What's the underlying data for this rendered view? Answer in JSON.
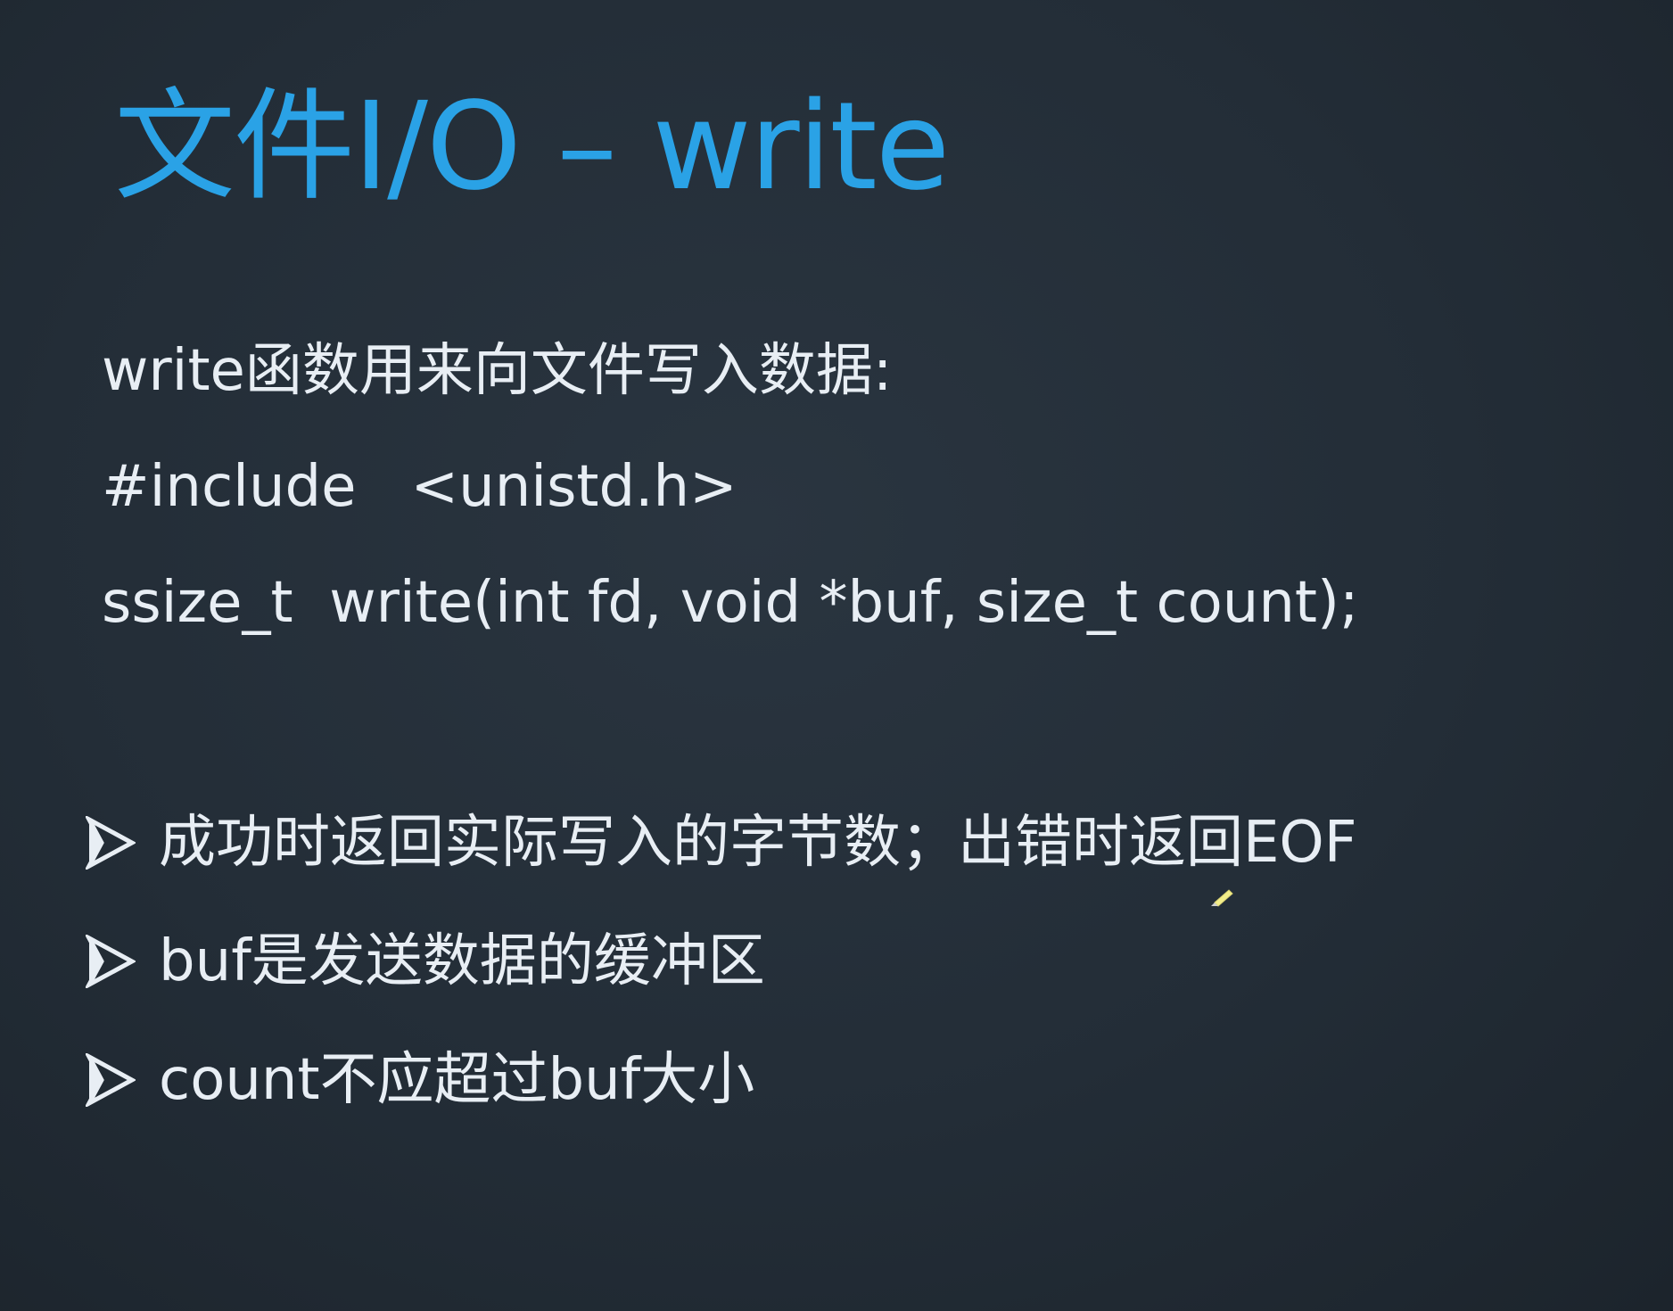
{
  "slide": {
    "title": "文件I/O – write",
    "lines": [
      "write函数用来向文件写入数据:",
      "#include   <unistd.h>",
      "ssize_t  write(int fd, void *buf, size_t count);"
    ],
    "bullets": [
      "成功时返回实际写入的字节数；出错时返回EOF",
      "buf是发送数据的缓冲区",
      "count不应超过buf大小"
    ],
    "colors": {
      "title": "#2aa2e6",
      "text": "#e8eef4",
      "background": "#232d37"
    },
    "icons": {
      "bullet": "arrow-bullet-icon",
      "cursor": "pen-cursor-icon"
    }
  }
}
